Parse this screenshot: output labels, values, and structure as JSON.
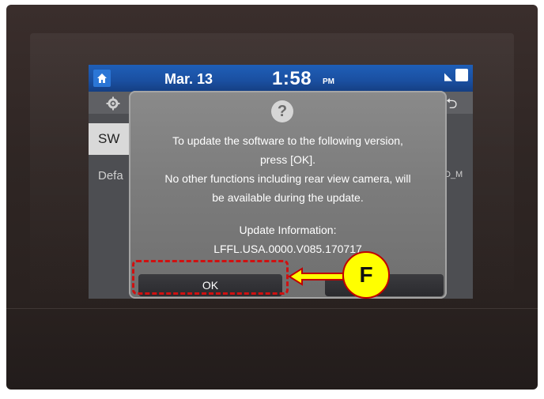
{
  "status_bar": {
    "date": "Mar. 13",
    "time": "1:58",
    "ampm": "PM"
  },
  "side": {
    "sw_tab": "SW",
    "default_label": "Defa",
    "right_label": "D_M"
  },
  "dialog": {
    "line1": "To update the software to the following version,",
    "line2": "press [OK].",
    "line3": "No other functions including rear view camera, will",
    "line4": "be available during the update.",
    "info_title": "Update Information:",
    "info_value": "LFFL.USA.0000.V085.170717",
    "ok_label": "OK"
  },
  "annotation": {
    "marker_label": "F",
    "callout_color": "#d01010",
    "marker_fill": "#ffff00"
  },
  "icons": {
    "home": "home-icon",
    "settings": "gear-icon",
    "back": "back-icon",
    "help": "question-icon"
  }
}
